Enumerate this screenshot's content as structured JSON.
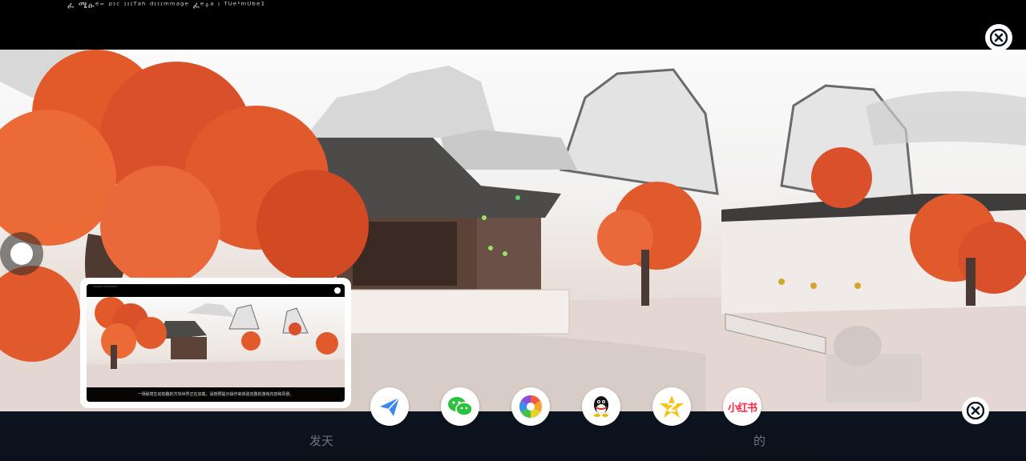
{
  "top_bar": {
    "garbled_text": "ፈ ሜፁᵉ⁼ ᵖᶦᶜ ᶦᶦᶦᵀᵃʰ ᵈᶦᶦᶦᵐᵐᵃᵍᵉ ፈᵉ፥ᵃ  ᵎ ᵀᵁᵉ'ᵐᵁᵇᵉ¹"
  },
  "preview": {
    "garbled_text": "ᵃᵀᵃᵁᵃᵀᵃ ᵃᵁᵃᵀᵃᵁᵃᵀᵃᵀᵃ",
    "caption": "一场秘境生动有趣的方块世界正在加载，请按照提示操作来体验完整的游戏内容和风景。"
  },
  "share": {
    "items": [
      {
        "name": "send",
        "icon": "paper-plane-icon",
        "color": "#3d86f0"
      },
      {
        "name": "wechat",
        "icon": "wechat-icon",
        "color": "#2bc13d"
      },
      {
        "name": "moments",
        "icon": "camera-aperture-icon",
        "color": "#f0a72b"
      },
      {
        "name": "qq",
        "icon": "qq-penguin-icon",
        "color": "#111111"
      },
      {
        "name": "qzone",
        "icon": "qzone-star-icon",
        "color": "#f6c417"
      },
      {
        "name": "xiaohongshu",
        "icon": "xiaohongshu-icon",
        "color": "#ff2442",
        "label": "小红书"
      }
    ]
  },
  "bottom_bar": {
    "caption_left": "发天",
    "caption_right": "的"
  },
  "colors": {
    "maple": "#e2552a",
    "roof": "#4d4b4a",
    "close_icon": "#0a1420"
  }
}
